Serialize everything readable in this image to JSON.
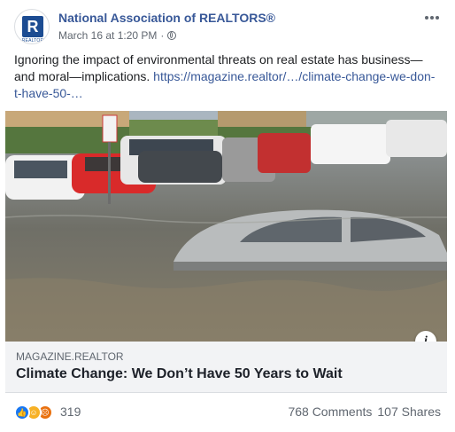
{
  "post": {
    "page_name": "National Association of REALTORS®",
    "avatar_caption": "REALTOR",
    "avatar_letter": "R",
    "timestamp": "March 16 at 1:20 PM",
    "separator": "·",
    "more_icon": "more-horizontal-icon",
    "text": "Ignoring the impact of environmental threats on real estate has business—and moral—implications. ",
    "link_text": "https://magazine.realtor/…/climate-change-we-don-t-have-50-…"
  },
  "link_card": {
    "domain": "MAGAZINE.REALTOR",
    "title": "Climate Change: We Don’t Have 50 Years to Wait",
    "info_label": "i"
  },
  "engagement": {
    "reactions": [
      "like",
      "haha",
      "angry"
    ],
    "reaction_count": "319",
    "comments": "768 Comments",
    "shares": "107 Shares"
  },
  "colors": {
    "link": "#385898",
    "like": "#1877f2",
    "haha": "#f7b125",
    "angry": "#e9710f"
  }
}
